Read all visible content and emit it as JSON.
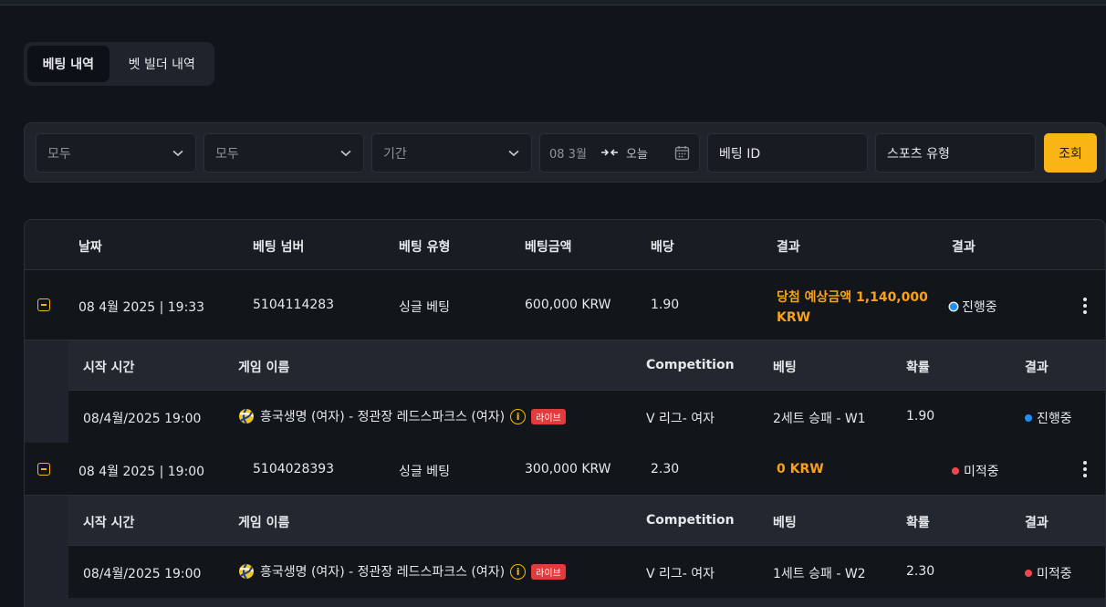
{
  "tabs": [
    {
      "label": "베팅 내역",
      "active": true
    },
    {
      "label": "벳 빌더 내역",
      "active": false
    }
  ],
  "filters": {
    "select1": "모두",
    "select2": "모두",
    "period": "기간",
    "date_from": "08 3월",
    "date_to": "오늘",
    "bet_id_placeholder": "베팅 ID",
    "sport_type_placeholder": "스포츠 유형",
    "search_label": "조회"
  },
  "table": {
    "headers": [
      "날짜",
      "베팅 넘버",
      "베팅 유형",
      "베팅금액",
      "배당",
      "결과",
      "결과"
    ],
    "sub_headers": [
      "시작 시간",
      "게임 이름",
      "Competition",
      "베팅",
      "확률",
      "결과"
    ],
    "rows": [
      {
        "date": "08 4월 2025 | 19:33",
        "bet_number": "5104114283",
        "bet_type": "싱글 베팅",
        "amount": "600,000 KRW",
        "odds": "1.90",
        "result_text": "당첨 예상금액 1,140,000",
        "result_text2": "KRW",
        "status": "진행중",
        "detail": {
          "start_time": "08/4월/2025 19:00",
          "game_name": "흥국생명 (여자) - 정관장 레드스파크스 (여자)",
          "live_label": "라이브",
          "competition": "V 리그- 여자",
          "bet": "2세트 승패 - W1",
          "probability": "1.90",
          "result": "진행중"
        }
      },
      {
        "date": "08 4월 2025 | 19:00",
        "bet_number": "5104028393",
        "bet_type": "싱글 베팅",
        "amount": "300,000 KRW",
        "odds": "2.30",
        "result_text": "0 KRW",
        "status": "미적중",
        "detail": {
          "start_time": "08/4월/2025 19:00",
          "game_name": "흥국생명 (여자) - 정관장 레드스파크스 (여자)",
          "live_label": "라이브",
          "competition": "V 리그- 여자",
          "bet": "1세트 승패 - W2",
          "probability": "2.30",
          "result": "미적중"
        }
      }
    ]
  },
  "colors": {
    "accent": "#f8b514",
    "status_in_progress": "#1e8ff5",
    "status_lost": "#f0474f",
    "live_badge": "#e23b3b"
  },
  "icons": [
    "chevron-down-icon",
    "arrows-icon",
    "calendar-icon",
    "collapse-icon",
    "kebab-icon",
    "volleyball-icon",
    "info-icon"
  ]
}
